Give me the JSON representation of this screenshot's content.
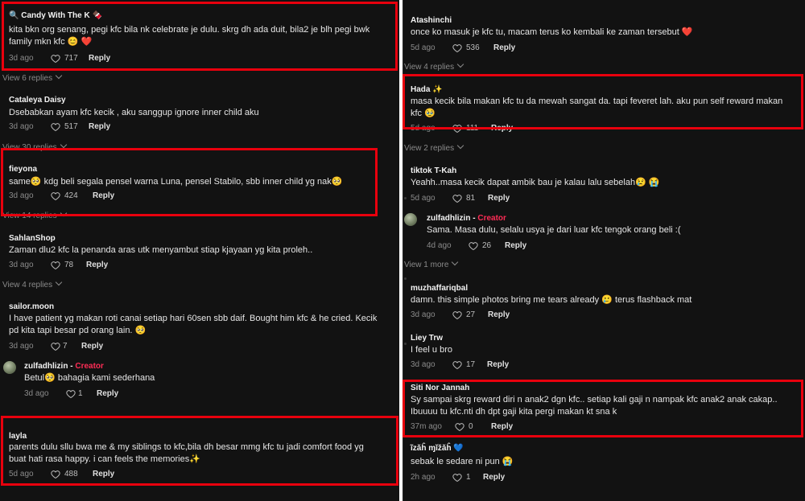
{
  "left_column": {
    "c1": {
      "user": "🔍 Candy With The K 🍫",
      "lines": [
        "kita bkn org senang, pegi kfc bila nk celebrate je dulu. skrg dh ada duit, bila2 je blh pegi bwk",
        "family mkn kfc 😊 ❤️"
      ],
      "time": "3d ago",
      "likes": "717",
      "reply": "Reply"
    },
    "v1": "View 6 replies",
    "c2": {
      "user": "Cataleya Daisy",
      "lines": [
        "Dsebabkan ayam kfc kecik , aku sanggup ignore inner child aku"
      ],
      "time": "3d ago",
      "likes": "517",
      "reply": "Reply"
    },
    "v2": "View 30 replies",
    "c3": {
      "user": "fieyona",
      "lines": [
        "same🥺 kdg beli segala pensel warna Luna, pensel Stabilo, sbb inner child yg nak🥺"
      ],
      "time": "3d ago",
      "likes": "424",
      "reply": "Reply"
    },
    "v3": "View 14 replies",
    "c4": {
      "user": "SahlanShop",
      "lines": [
        "Zaman dlu2 kfc la penanda aras utk menyambut stiap kjayaan yg kita proleh.."
      ],
      "time": "3d ago",
      "likes": "78",
      "reply": "Reply"
    },
    "v4": "View 4 replies",
    "c5": {
      "user": "sailor.moon",
      "lines": [
        "I have patient yg makan roti canai setiap hari 60sen sbb daif. Bought him kfc & he cried. Kecik",
        "pd kita tapi besar pd orang lain. 🥺"
      ],
      "time": "3d ago",
      "likes": "7",
      "reply": "Reply"
    },
    "c6": {
      "user": "zulfadhlizin",
      "creator": "Creator",
      "lines": [
        "Betul🥺 bahagia kami sederhana"
      ],
      "time": "3d ago",
      "likes": "1",
      "reply": "Reply"
    },
    "c7": {
      "user": "layla",
      "lines": [
        "parents dulu sllu bwa me & my siblings to kfc,bila dh besar mmg kfc tu jadi comfort food yg",
        "buat hati rasa happy. i can feels the memories✨"
      ],
      "time": "5d ago",
      "likes": "488",
      "reply": "Reply"
    }
  },
  "right_column": {
    "r1": {
      "user": "Atashinchi",
      "lines": [
        "once ko masuk je kfc tu, macam terus ko kembali ke zaman tersebut ❤️"
      ],
      "time": "5d ago",
      "likes": "536",
      "reply": "Reply"
    },
    "rv1": "View 4 replies",
    "r2": {
      "user": "Hada ✨",
      "lines": [
        "masa kecik bila makan kfc tu da mewah sangat da. tapi feveret lah. aku pun self reward makan",
        "kfc 🥹"
      ],
      "time": "5d ago",
      "likes": "111",
      "reply": "Reply"
    },
    "rv2": "View 2 replies",
    "r3": {
      "user": "tiktok T-Kah",
      "lines": [
        "Yeahh..masa kecik dapat ambik bau je kalau lalu sebelah😢 😭"
      ],
      "time": "5d ago",
      "likes": "81",
      "reply": "Reply"
    },
    "r4": {
      "user": "zulfadhlizin",
      "creator": "Creator",
      "lines": [
        "Sama. Masa dulu, selalu usya je dari luar kfc tengok orang beli :("
      ],
      "time": "4d ago",
      "likes": "26",
      "reply": "Reply"
    },
    "rv3": "View 1 more",
    "r5": {
      "user": "muzhaffariqbal",
      "lines": [
        "damn. this simple photos bring me tears already 🥲 terus flashback mat"
      ],
      "time": "3d ago",
      "likes": "27",
      "reply": "Reply"
    },
    "r6": {
      "user": "Liey Trw",
      "lines": [
        "I feel u bro"
      ],
      "time": "3d ago",
      "likes": "17",
      "reply": "Reply"
    },
    "r7": {
      "user": "Siti Nor Jannah",
      "lines": [
        "Sy sampai skrg reward diri n anak2 dgn kfc.. setiap kali gaji n nampak kfc anak2 anak cakap..",
        "Ibuuuu tu kfc.nti dh dpt gaji kita pergi makan kt sna k"
      ],
      "time": "37m ago",
      "likes": "0",
      "reply": "Reply"
    },
    "r8": {
      "user": "ĩzăĥ ɱĭžăĥ 💙",
      "lines": [
        "sebak le sedare ni pun 😭"
      ],
      "time": "2h ago",
      "likes": "1",
      "reply": "Reply"
    }
  },
  "colors": {
    "background": "#121212",
    "highlight": "#e8000d",
    "creator": "#fe2c55",
    "muted": "#8a8a8a"
  },
  "icons": {
    "like": "heart-outline-icon",
    "expand": "chevron-down-icon"
  }
}
